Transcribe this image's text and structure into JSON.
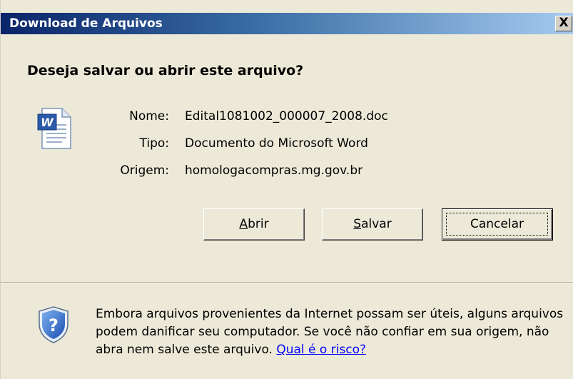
{
  "dialog": {
    "title": "Download de Arquivos",
    "close_label": "X",
    "question": "Deseja salvar ou abrir este arquivo?"
  },
  "file_info": {
    "name_label": "Nome:",
    "name_value": "Edital1081002_000007_2008.doc",
    "type_label": "Tipo:",
    "type_value": "Documento do Microsoft Word",
    "origin_label": "Origem:",
    "origin_value": "homologacompras.mg.gov.br",
    "icon": "word-document-icon"
  },
  "buttons": {
    "open": {
      "accel": "A",
      "rest": "brir"
    },
    "save": {
      "accel": "S",
      "rest": "alvar"
    },
    "cancel": "Cancelar"
  },
  "warning": {
    "icon": "shield-question-icon",
    "text": "Embora arquivos provenientes da Internet possam ser úteis, alguns arquivos podem danificar seu computador. Se você não confiar em sua origem, não abra nem salve este arquivo.",
    "link": "Qual é o risco?"
  },
  "colors": {
    "titlebar_start": "#0a246a",
    "titlebar_end": "#a6caf0",
    "dialog_bg": "#ece9d8",
    "link": "#0000ff"
  }
}
